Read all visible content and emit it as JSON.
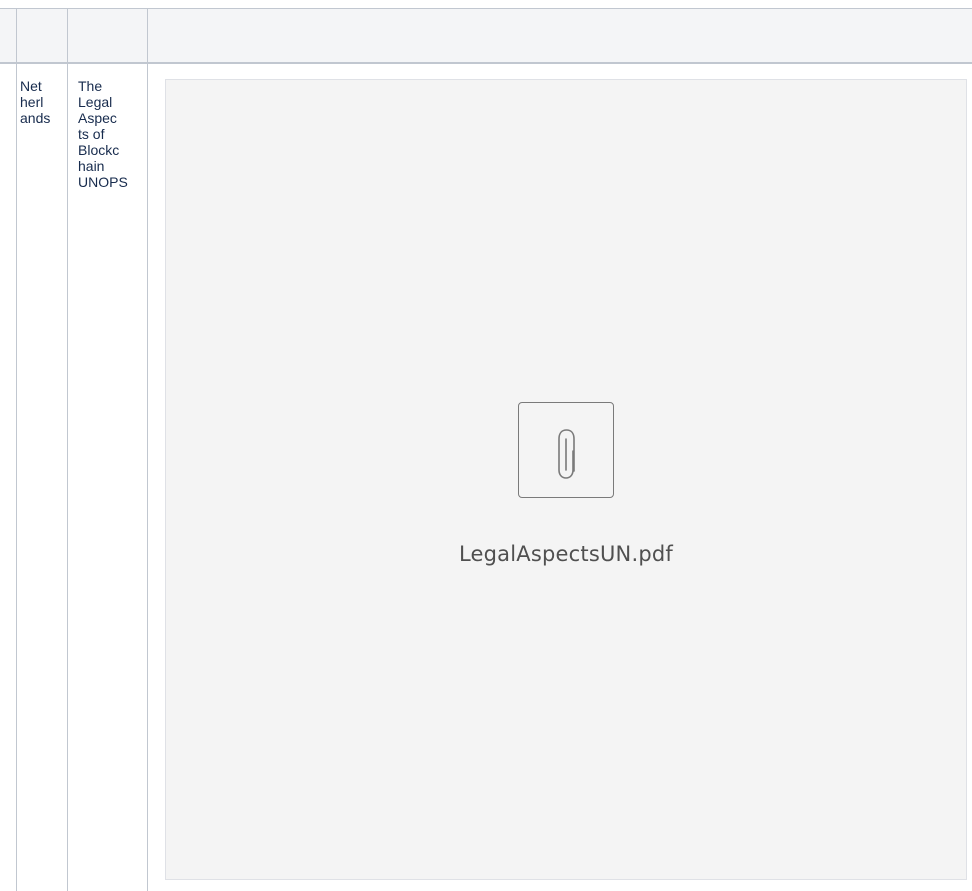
{
  "table": {
    "header": {
      "col1": "",
      "col2": "",
      "col3": ""
    },
    "rows": [
      {
        "country": "Net\nherl\nands",
        "document": "The\nLegal\nAspec\nts of\nBlockc\nhain\nUNOPS",
        "attachment": {
          "icon": "paperclip-icon",
          "file_name": "LegalAspectsUN.pdf"
        }
      }
    ]
  },
  "colors": {
    "header_background": "#f4f5f7",
    "grid_line": "#c1c7d0",
    "preview_background": "#f4f4f4",
    "text": "#172b4d"
  }
}
